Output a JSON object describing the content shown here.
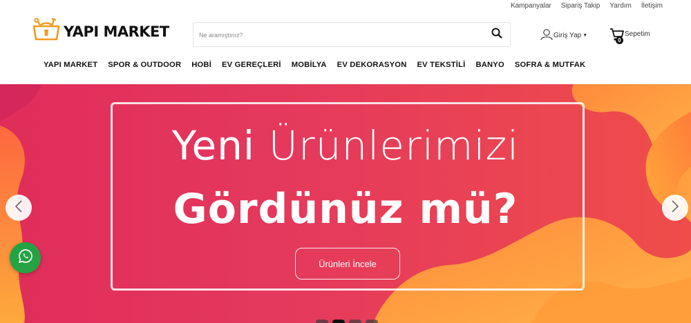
{
  "toplinks": [
    "Kampanyalar",
    "Sipariş Takip",
    "Yardım",
    "İletişim"
  ],
  "logo": {
    "text": "YAPI MARKET",
    "icon": "tools-bag-logo"
  },
  "search": {
    "placeholder": "Ne aramıştınız?",
    "value": "",
    "icon": "search-icon"
  },
  "login": {
    "label": "Giriş Yap",
    "icon": "user-icon"
  },
  "cart": {
    "label": "Sepetim",
    "count": "0",
    "icon": "cart-icon"
  },
  "nav": [
    "YAPI MARKET",
    "SPOR & OUTDOOR",
    "HOBİ",
    "EV GEREÇLERİ",
    "MOBİLYA",
    "EV DEKORASYON",
    "EV TEKSTİLİ",
    "BANYO",
    "SOFRA & MUTFAK"
  ],
  "hero": {
    "line1_light_a": "Yeni ",
    "line1_light_b": "Ürünlerimizi",
    "line2": "Gördünüz mü?",
    "cta": "Ürünleri İncele",
    "slide_count": 4,
    "active_slide": 2
  },
  "colors": {
    "accent": "#f39a1d",
    "hero_pink": "#e02d5b",
    "whatsapp": "#25a244"
  }
}
